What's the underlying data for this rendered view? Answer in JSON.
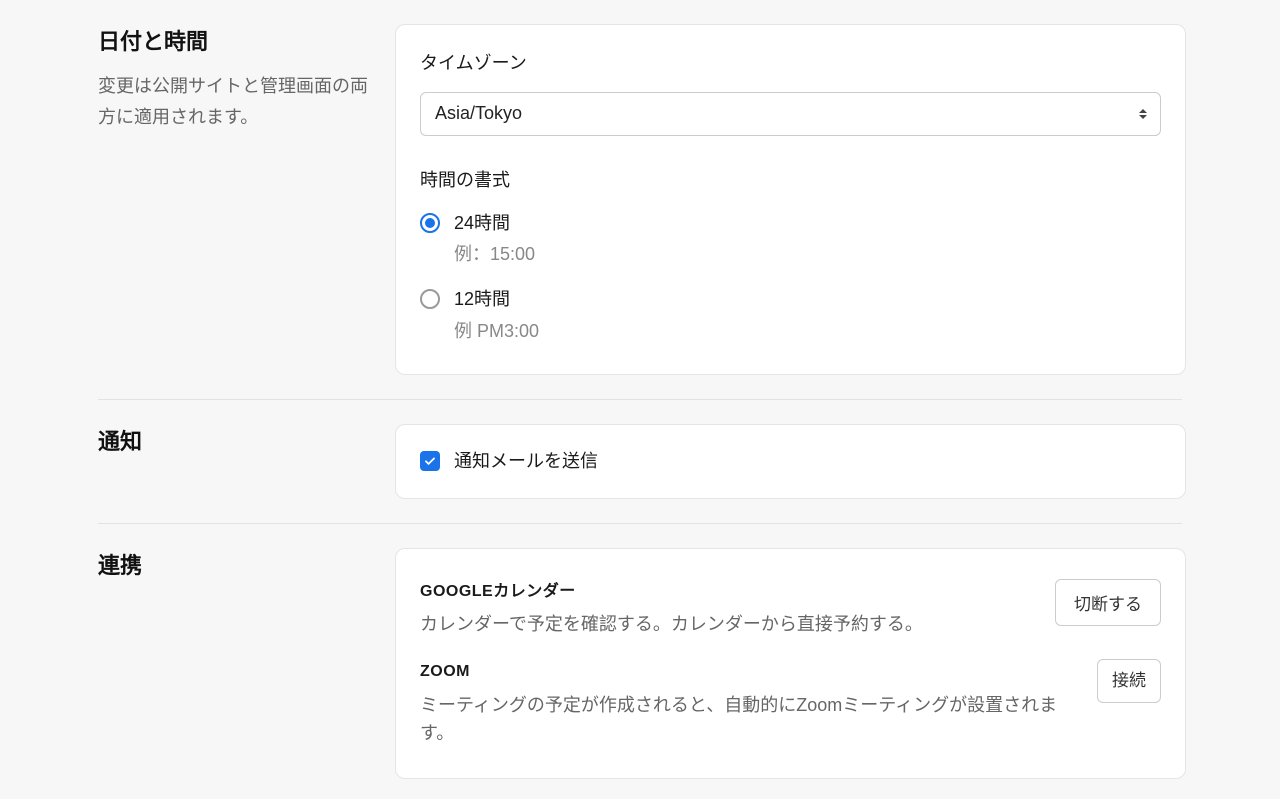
{
  "dateTime": {
    "heading": "日付と時間",
    "description": "変更は公開サイトと管理画面の両方に適用されます。",
    "timezone": {
      "label": "タイムゾーン",
      "value": "Asia/Tokyo"
    },
    "timeFormat": {
      "label": "時間の書式",
      "options": [
        {
          "label": "24時間",
          "example": "例：15:00",
          "selected": true
        },
        {
          "label": "12時間",
          "example": "例 PM3:00",
          "selected": false
        }
      ]
    }
  },
  "notifications": {
    "heading": "通知",
    "emailCheckbox": {
      "label": "通知メールを送信",
      "checked": true
    }
  },
  "integrations": {
    "heading": "連携",
    "items": [
      {
        "title": "GOOGLEカレンダー",
        "description": "カレンダーで予定を確認する。カレンダーから直接予約する。",
        "button": "切断する"
      },
      {
        "title": "ZOOM",
        "description": "ミーティングの予定が作成されると、自動的にZoomミーティングが設置されます。",
        "button": "接続"
      }
    ]
  }
}
